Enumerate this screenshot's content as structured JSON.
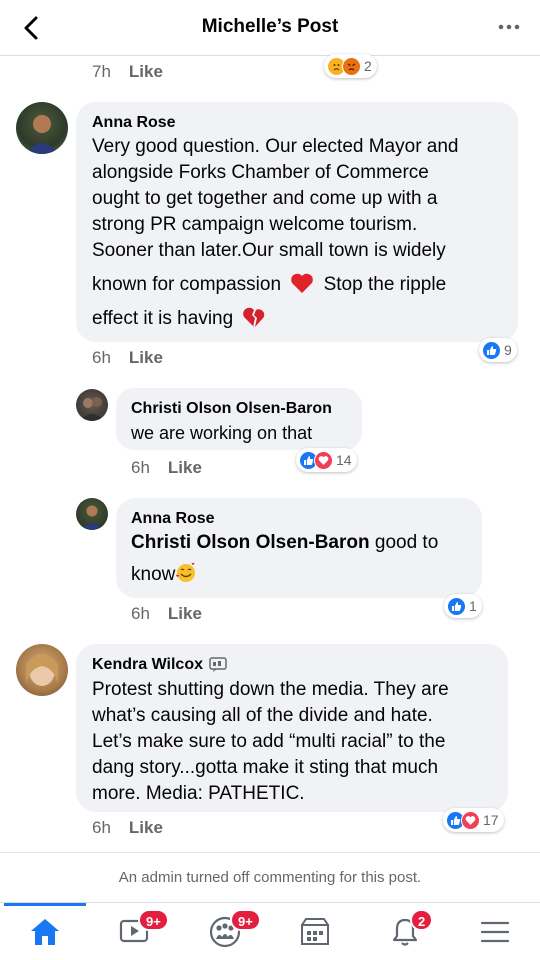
{
  "header": {
    "title": "Michelle’s Post"
  },
  "top_meta": {
    "time": "7h",
    "like": "Like",
    "react_count": "2"
  },
  "comments": [
    {
      "author": "Anna Rose",
      "text_lines": [
        "Very good question. Our elected Mayor and",
        "alongside Forks Chamber of Commerce",
        "ought to get together and come up with a",
        "strong PR campaign welcome tourism.",
        "Sooner than later.Our small town is widely",
        "known for compassion",
        "Stop the ripple",
        "effect it is having"
      ],
      "time": "6h",
      "like": "Like",
      "react_count": "9"
    },
    {
      "author": "Christi Olson Olsen-Baron",
      "text": "we are working on that",
      "time": "6h",
      "like": "Like",
      "react_count": "14"
    },
    {
      "author": "Anna Rose",
      "mention": "Christi Olson Olsen-Baron",
      "text_after": "good to",
      "text_line2": "know",
      "time": "6h",
      "like": "Like",
      "react_count": "1"
    },
    {
      "author": "Kendra Wilcox",
      "text_lines": [
        "Protest shutting down the media. They are",
        "what’s causing all of the divide and hate.",
        "Let’s make sure to add “multi racial” to the",
        "dang story...gotta make it sting that much",
        "more. Media: PATHETIC."
      ],
      "time": "6h",
      "like": "Like",
      "react_count": "17"
    }
  ],
  "admin_notice": "An admin turned off commenting for this post.",
  "tabbar": {
    "video_badge": "9+",
    "groups_badge": "9+",
    "notifications_badge": "2"
  },
  "colors": {
    "accent": "#1877f2",
    "bubble": "#f0f2f5",
    "badge": "#e41e3f"
  }
}
